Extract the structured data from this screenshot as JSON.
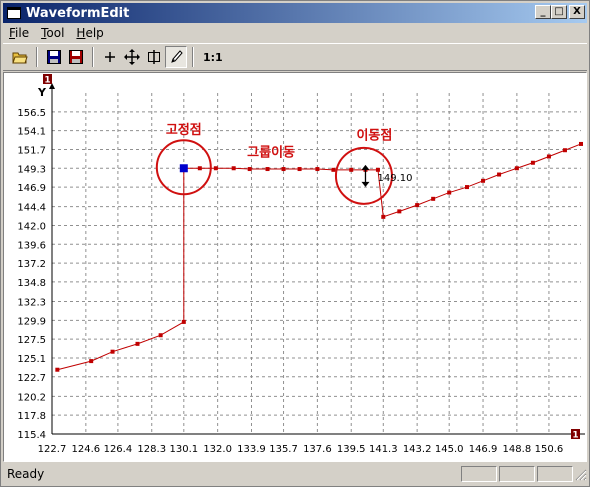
{
  "window": {
    "title": "WaveformEdit",
    "minimize": "_",
    "maximize": "□",
    "close": "X"
  },
  "menu": [
    {
      "label": "File",
      "key": "F",
      "rest": "ile"
    },
    {
      "label": "Tool",
      "key": "T",
      "rest": "ool"
    },
    {
      "label": "Help",
      "key": "H",
      "rest": "elp"
    }
  ],
  "toolbar": {
    "icons": [
      "open-folder-icon",
      "save-icon",
      "save-as-icon",
      "add-point-icon",
      "move-icon",
      "split-icon",
      "pencil-icon"
    ],
    "zoom_label": "1:1"
  },
  "status": {
    "text": "Ready"
  },
  "chart_data": {
    "type": "line",
    "ylabel": "Y",
    "axis_badge": "1",
    "x_ticks": [
      "122.7",
      "124.6",
      "126.4",
      "128.3",
      "130.1",
      "132.0",
      "133.9",
      "135.7",
      "137.6",
      "139.5",
      "141.3",
      "143.2",
      "145.0",
      "146.9",
      "148.8",
      "150.6"
    ],
    "y_ticks": [
      "156.5",
      "154.1",
      "151.7",
      "149.3",
      "146.9",
      "144.4",
      "142.0",
      "139.6",
      "137.2",
      "134.8",
      "132.3",
      "129.9",
      "127.5",
      "125.1",
      "122.7",
      "120.2",
      "117.8",
      "115.4"
    ],
    "xlim": [
      122.7,
      152.4
    ],
    "ylim": [
      115.4,
      158.9
    ],
    "grid": true,
    "color": "#c00000",
    "series": [
      {
        "x": [
          123.0,
          124.9,
          126.1,
          127.5,
          128.8,
          130.1
        ],
        "y": [
          123.6,
          124.7,
          125.9,
          126.9,
          128.0,
          129.7
        ]
      },
      {
        "x": [
          130.1,
          131.0,
          131.9,
          132.9,
          133.8,
          134.8,
          135.7,
          136.6,
          137.6,
          138.5,
          139.5,
          140.3,
          141.0
        ],
        "y": [
          149.3,
          149.3,
          149.3,
          149.3,
          149.2,
          149.2,
          149.2,
          149.2,
          149.2,
          149.1,
          149.1,
          149.1,
          149.1
        ]
      },
      {
        "x": [
          141.3,
          142.2,
          143.2,
          144.1,
          145.0,
          146.0,
          146.9,
          147.8,
          148.8,
          149.7,
          150.6,
          151.5,
          152.4
        ],
        "y": [
          143.1,
          143.8,
          144.6,
          145.4,
          146.2,
          146.9,
          147.7,
          148.5,
          149.3,
          150.0,
          150.8,
          151.6,
          152.4
        ]
      }
    ],
    "fixed_point": {
      "x": 130.1,
      "y": 149.3,
      "color": "#0000cc"
    },
    "annotations": [
      {
        "text": "고정점",
        "x": 130.1,
        "y": 153.7
      },
      {
        "text": "그룹이동",
        "x": 135.0,
        "y": 150.8
      },
      {
        "text": "이동점",
        "x": 140.8,
        "y": 153.0
      }
    ],
    "value_readout": "149.10"
  }
}
